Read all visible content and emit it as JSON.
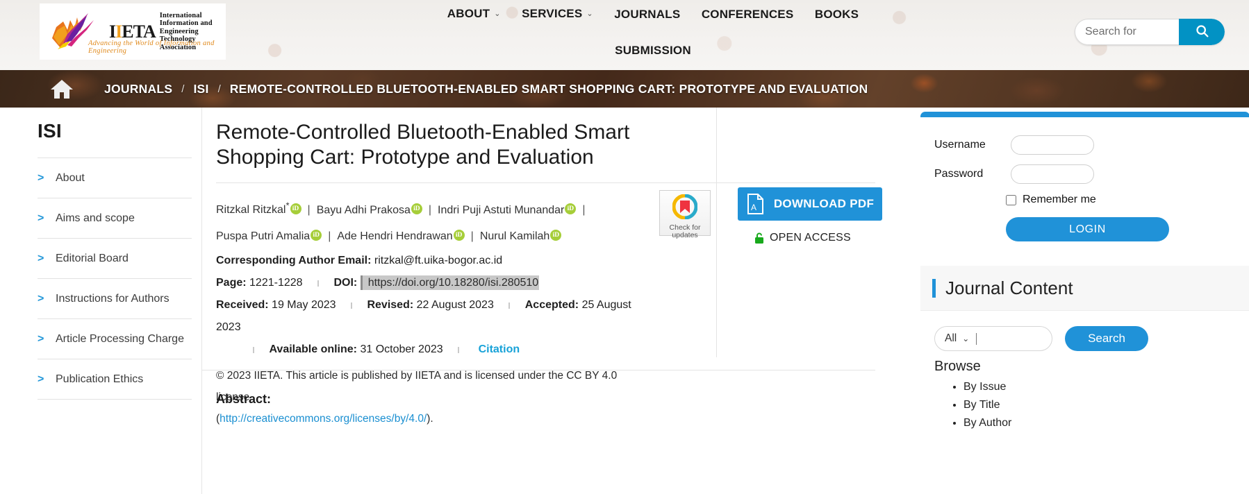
{
  "header": {
    "logo": {
      "acronym": "IIETA",
      "line1": "International Information and",
      "line2": "Engineering Technology Association",
      "tagline": "Advancing the World of Information and Engineering"
    },
    "nav": [
      {
        "label": "ABOUT",
        "caret": "⌄"
      },
      {
        "label": "SERVICES",
        "caret": "⌄"
      },
      {
        "label": "JOURNALS",
        "caret": ""
      },
      {
        "label": "CONFERENCES",
        "caret": ""
      },
      {
        "label": "BOOKS",
        "caret": ""
      }
    ],
    "nav_row2": [
      {
        "label": "SUBMISSION",
        "caret": ""
      }
    ],
    "search": {
      "placeholder": "Search for",
      "value": "",
      "icon": "search-icon",
      "accent": "#0292c4"
    }
  },
  "breadcrumb": {
    "home_icon": "home-icon",
    "journals": "JOURNALS",
    "sep1": "/",
    "journal": "ISI",
    "sep2": "/",
    "current": "REMOTE-CONTROLLED BLUETOOTH-ENABLED SMART SHOPPING CART: PROTOTYPE AND EVALUATION"
  },
  "sidebar": {
    "title": "ISI",
    "items": [
      {
        "label": "About"
      },
      {
        "label": "Aims and scope"
      },
      {
        "label": "Editorial Board"
      },
      {
        "label": "Instructions for Authors"
      },
      {
        "label": "Article Processing Charge"
      },
      {
        "label": "Publication Ethics"
      }
    ]
  },
  "article": {
    "title": "Remote-Controlled Bluetooth-Enabled Smart Shopping Cart: Prototype and Evaluation",
    "authors_row1": [
      {
        "name": "Ritzkal Ritzkal",
        "corresponding": "*",
        "orcid": "iD"
      },
      {
        "name": "Bayu Adhi Prakosa",
        "corresponding": "",
        "orcid": "iD"
      },
      {
        "name": "Indri Puji Astuti Munandar",
        "corresponding": "",
        "orcid": "iD"
      }
    ],
    "authors_row2": [
      {
        "name": "Puspa Putri Amalia",
        "corresponding": "",
        "orcid": "iD"
      },
      {
        "name": "Ade Hendri Hendrawan",
        "corresponding": "",
        "orcid": "iD"
      },
      {
        "name": "Nurul Kamilah",
        "corresponding": "",
        "orcid": "iD"
      }
    ],
    "author_separator": "|",
    "email_label": "Corresponding Author Email:",
    "email_value": "ritzkal@ft.uika-bogor.ac.id",
    "page_label": "Page:",
    "page_value": "1221-1228",
    "doi_label": "DOI:",
    "doi_value": "https://doi.org/10.18280/isi.280510",
    "received_label": "Received:",
    "received_value": "19 May 2023",
    "revised_label": "Revised:",
    "revised_value": "22 August 2023",
    "accepted_label": "Accepted:",
    "accepted_value": "25 August 2023",
    "available_label": "Available online:",
    "available_value": "31 October 2023",
    "citation_label": "Citation",
    "license_text_1": "© 2023 IIETA. This article is published by IIETA and is licensed under the CC BY 4.0 license",
    "license_open_paren": "(",
    "license_link": "http://creativecommons.org/licenses/by/4.0/",
    "license_close_paren": ").",
    "crossmark": {
      "line1": "Check for",
      "line2": "updates",
      "icon": "crossmark-icon"
    },
    "download_label": "DOWNLOAD PDF",
    "download_icon": "pdf-file-icon",
    "open_access_label": "OPEN ACCESS",
    "open_access_icon": "green-lock-icon",
    "abstract_heading": "Abstract:"
  },
  "login": {
    "username_label": "Username",
    "username_value": "",
    "password_label": "Password",
    "password_value": "",
    "remember_label": "Remember me",
    "remember_checked": false,
    "login_label": "LOGIN",
    "accent": "#2092d8"
  },
  "journal_content": {
    "title": "Journal Content",
    "select_value": "All",
    "select_caret": "⌄",
    "search_value": "",
    "search_button": "Search",
    "browse_heading": "Browse",
    "browse_items": [
      {
        "label": "By Issue"
      },
      {
        "label": "By Title"
      },
      {
        "label": "By Author"
      }
    ]
  }
}
